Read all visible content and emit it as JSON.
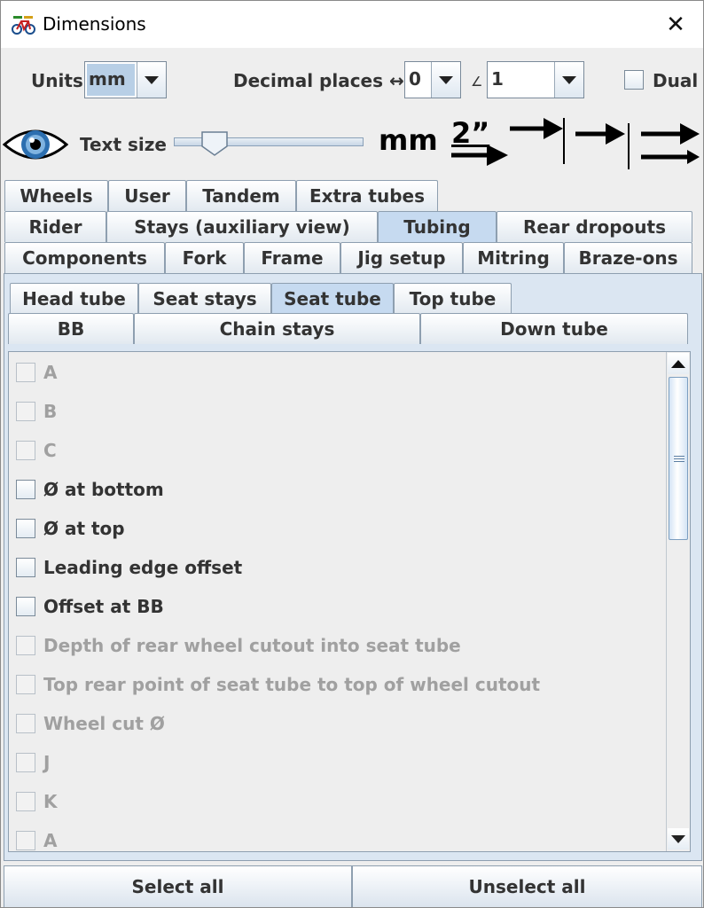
{
  "window": {
    "title": "Dimensions",
    "close_glyph": "✕"
  },
  "units": {
    "label": "Units",
    "value": "mm"
  },
  "decimal": {
    "label": "Decimal places ↔",
    "linear_value": "0",
    "angle_symbol": "∠",
    "angle_value": "1"
  },
  "dual": {
    "label": "Dual",
    "checked": false
  },
  "text_size": {
    "label": "Text size",
    "level": 0.2
  },
  "style_icons": {
    "mm_label": "mm",
    "inch_label": "2”"
  },
  "tabs_row1": [
    "Wheels",
    "User",
    "Tandem",
    "Extra tubes"
  ],
  "tabs_row2": [
    "Rider",
    "Stays (auxiliary view)",
    "Tubing",
    "Rear dropouts"
  ],
  "tabs_row3": [
    "Components",
    "Fork",
    "Frame",
    "Jig setup",
    "Mitring",
    "Braze-ons"
  ],
  "subtabs_row1": [
    "Head tube",
    "Seat stays",
    "Seat tube",
    "Top tube"
  ],
  "subtabs_row2": [
    "BB",
    "Chain stays",
    "Down tube"
  ],
  "selected_tab": "Tubing",
  "selected_subtab": "Seat tube",
  "items": [
    {
      "label": "A",
      "enabled": false,
      "checked": false
    },
    {
      "label": "B",
      "enabled": false,
      "checked": false
    },
    {
      "label": "C",
      "enabled": false,
      "checked": false
    },
    {
      "label": "Ø at bottom",
      "enabled": true,
      "checked": false
    },
    {
      "label": "Ø at top",
      "enabled": true,
      "checked": false
    },
    {
      "label": "Leading edge offset",
      "enabled": true,
      "checked": false
    },
    {
      "label": "Offset at BB",
      "enabled": true,
      "checked": false
    },
    {
      "label": "Depth of rear wheel cutout into seat tube",
      "enabled": false,
      "checked": false
    },
    {
      "label": "Top rear point of seat tube to top of wheel cutout",
      "enabled": false,
      "checked": false
    },
    {
      "label": "Wheel cut Ø",
      "enabled": false,
      "checked": false
    },
    {
      "label": "J",
      "enabled": false,
      "checked": false
    },
    {
      "label": "K",
      "enabled": false,
      "checked": false
    },
    {
      "label": "A",
      "enabled": false,
      "checked": false
    }
  ],
  "buttons": {
    "select_all": "Select all",
    "unselect_all": "Unselect all"
  },
  "icons": [
    "bicycle-icon",
    "close-icon",
    "chevron-down-icon",
    "eye-icon",
    "mm-units-icon",
    "inch-units-icon",
    "arrow-style-icon"
  ],
  "colors": {
    "selected_tab": "#c6daf0",
    "disabled_text": "#a0a0a0",
    "panel_bg": "#eeeeee"
  }
}
